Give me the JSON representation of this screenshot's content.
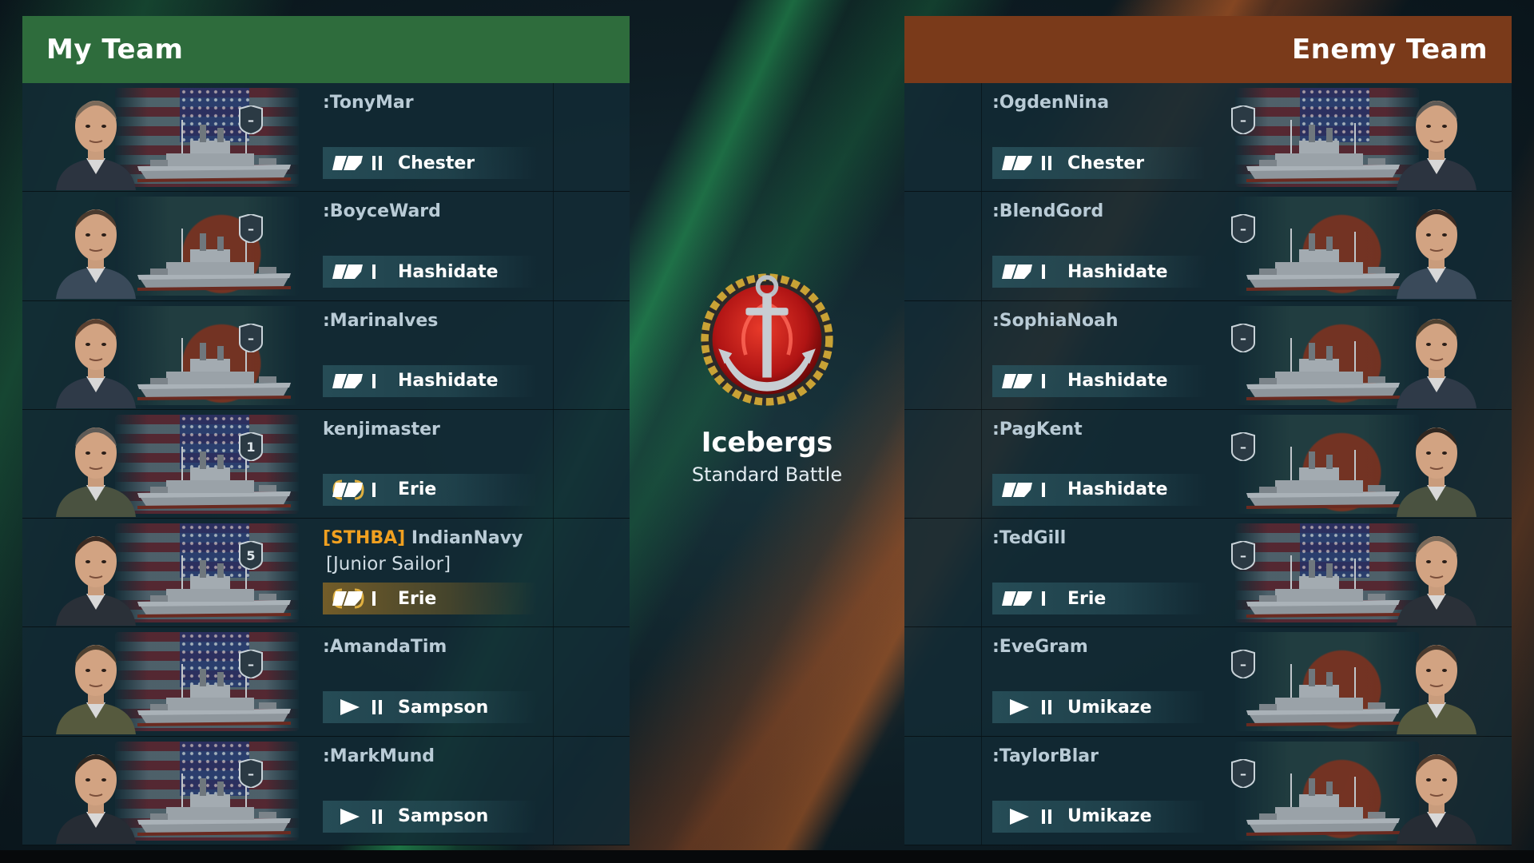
{
  "battle": {
    "map": "Icebergs",
    "mode": "Standard Battle"
  },
  "my_team": {
    "title": "My Team",
    "players": [
      {
        "name": ":TonyMar",
        "clan": "",
        "rank": "",
        "ship": "Chester",
        "type": "cruiser",
        "tier": "II",
        "nation": "us",
        "status": "minus",
        "premium": false
      },
      {
        "name": ":BoyceWard",
        "clan": "",
        "rank": "",
        "ship": "Hashidate",
        "type": "cruiser",
        "tier": "I",
        "nation": "jp",
        "status": "minus",
        "premium": false
      },
      {
        "name": ":Marinalves",
        "clan": "",
        "rank": "",
        "ship": "Hashidate",
        "type": "cruiser",
        "tier": "I",
        "nation": "jp",
        "status": "minus",
        "premium": false
      },
      {
        "name": "kenjimaster",
        "clan": "",
        "rank": "",
        "ship": "Erie",
        "type": "cruiser",
        "tier": "I",
        "nation": "us",
        "status": "1",
        "premium": true
      },
      {
        "name": "IndianNavy",
        "clan": "[STHBA]",
        "rank": "[Junior Sailor]",
        "ship": "Erie",
        "type": "cruiser",
        "tier": "I",
        "nation": "us",
        "status": "5",
        "premium": true,
        "highlight": true
      },
      {
        "name": ":AmandaTim",
        "clan": "",
        "rank": "",
        "ship": "Sampson",
        "type": "destroyer",
        "tier": "II",
        "nation": "us",
        "status": "minus",
        "premium": false
      },
      {
        "name": ":MarkMund",
        "clan": "",
        "rank": "",
        "ship": "Sampson",
        "type": "destroyer",
        "tier": "II",
        "nation": "us",
        "status": "minus",
        "premium": false
      }
    ]
  },
  "enemy_team": {
    "title": "Enemy Team",
    "players": [
      {
        "name": ":OgdenNina",
        "ship": "Chester",
        "type": "cruiser",
        "tier": "II",
        "nation": "us",
        "status": "minus"
      },
      {
        "name": ":BlendGord",
        "ship": "Hashidate",
        "type": "cruiser",
        "tier": "I",
        "nation": "jp",
        "status": "minus"
      },
      {
        "name": ":SophiaNoah",
        "ship": "Hashidate",
        "type": "cruiser",
        "tier": "I",
        "nation": "jp",
        "status": "minus"
      },
      {
        "name": ":PagKent",
        "ship": "Hashidate",
        "type": "cruiser",
        "tier": "I",
        "nation": "jp",
        "status": "minus"
      },
      {
        "name": ":TedGill",
        "ship": "Erie",
        "type": "cruiser",
        "tier": "I",
        "nation": "us",
        "status": "minus"
      },
      {
        "name": ":EveGram",
        "ship": "Umikaze",
        "type": "destroyer",
        "tier": "II",
        "nation": "jp",
        "status": "minus"
      },
      {
        "name": ":TaylorBlar",
        "ship": "Umikaze",
        "type": "destroyer",
        "tier": "II",
        "nation": "jp",
        "status": "minus"
      }
    ]
  },
  "colors": {
    "my_header": "#2e6c3c",
    "enemy_header": "#7a3a1a",
    "clan_tag": "#f0a020"
  }
}
